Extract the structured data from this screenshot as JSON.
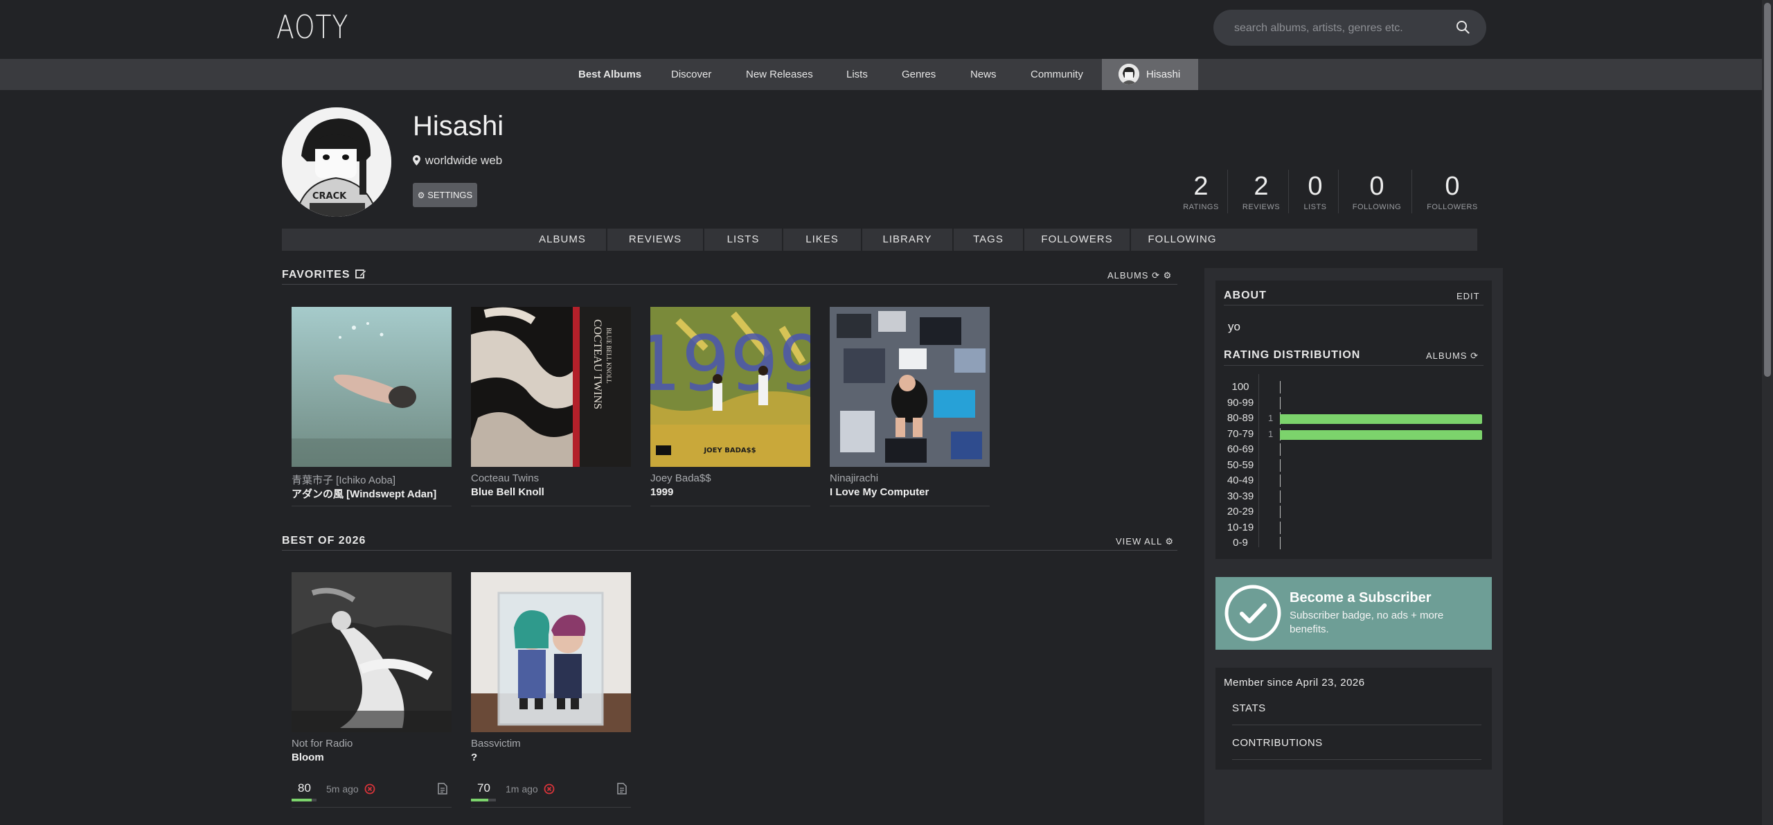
{
  "header": {
    "logo": "AOTY",
    "search_placeholder": "search albums, artists, genres etc."
  },
  "nav": {
    "items": [
      "Best Albums",
      "Discover",
      "New Releases",
      "Lists",
      "Genres",
      "News",
      "Community"
    ],
    "user": "Hisashi"
  },
  "profile": {
    "name": "Hisashi",
    "location": "worldwide web",
    "settings_label": "SETTINGS",
    "stats": [
      {
        "value": "2",
        "label": "RATINGS"
      },
      {
        "value": "2",
        "label": "REVIEWS"
      },
      {
        "value": "0",
        "label": "LISTS"
      },
      {
        "value": "0",
        "label": "FOLLOWING"
      },
      {
        "value": "0",
        "label": "FOLLOWERS"
      }
    ],
    "tabs": [
      "ALBUMS",
      "REVIEWS",
      "LISTS",
      "LIKES",
      "LIBRARY",
      "TAGS",
      "FOLLOWERS",
      "FOLLOWING"
    ]
  },
  "favorites": {
    "title": "FAVORITES",
    "right_label": "ALBUMS",
    "albums": [
      {
        "artist": "青葉市子 [Ichiko Aoba]",
        "title": "アダンの風 [Windswept Adan]"
      },
      {
        "artist": "Cocteau Twins",
        "title": "Blue Bell Knoll"
      },
      {
        "artist": "Joey Bada$$",
        "title": "1999"
      },
      {
        "artist": "Ninajirachi",
        "title": "I Love My Computer"
      }
    ],
    "cover_text": {
      "cocteau_1": "COCTEAU TWINS",
      "cocteau_2": "BLUE BELL KNOLL",
      "joey_big": "1999",
      "joey_name": "JOEY BADA$$"
    }
  },
  "best": {
    "title": "BEST OF 2026",
    "right_label": "VIEW ALL",
    "albums": [
      {
        "artist": "Not for Radio",
        "title": "Bloom",
        "rating": "80",
        "rating_fraction": 0.8,
        "ago": "5m ago"
      },
      {
        "artist": "Bassvictim",
        "title": "?",
        "rating": "70",
        "rating_fraction": 0.7,
        "ago": "1m ago"
      }
    ]
  },
  "about": {
    "title": "ABOUT",
    "edit_label": "EDIT",
    "text": "yo"
  },
  "distribution": {
    "title": "RATING DISTRIBUTION",
    "right_label": "ALBUMS",
    "rows": [
      {
        "label": "100",
        "count": ""
      },
      {
        "label": "90-99",
        "count": ""
      },
      {
        "label": "80-89",
        "count": "1"
      },
      {
        "label": "70-79",
        "count": "1"
      },
      {
        "label": "60-69",
        "count": ""
      },
      {
        "label": "50-59",
        "count": ""
      },
      {
        "label": "40-49",
        "count": ""
      },
      {
        "label": "30-39",
        "count": ""
      },
      {
        "label": "20-29",
        "count": ""
      },
      {
        "label": "10-19",
        "count": ""
      },
      {
        "label": "0-9",
        "count": ""
      }
    ]
  },
  "subscribe": {
    "title": "Become a Subscriber",
    "desc": "Subscriber badge, no ads + more benefits."
  },
  "member": {
    "since": "Member since April 23, 2026",
    "links": [
      "STATS",
      "CONTRIBUTIONS"
    ]
  },
  "colors": {
    "background": "#222326",
    "accent_green": "#7cd36c",
    "subscribe_teal": "#6e9e96",
    "remove_red": "#d9343a"
  }
}
